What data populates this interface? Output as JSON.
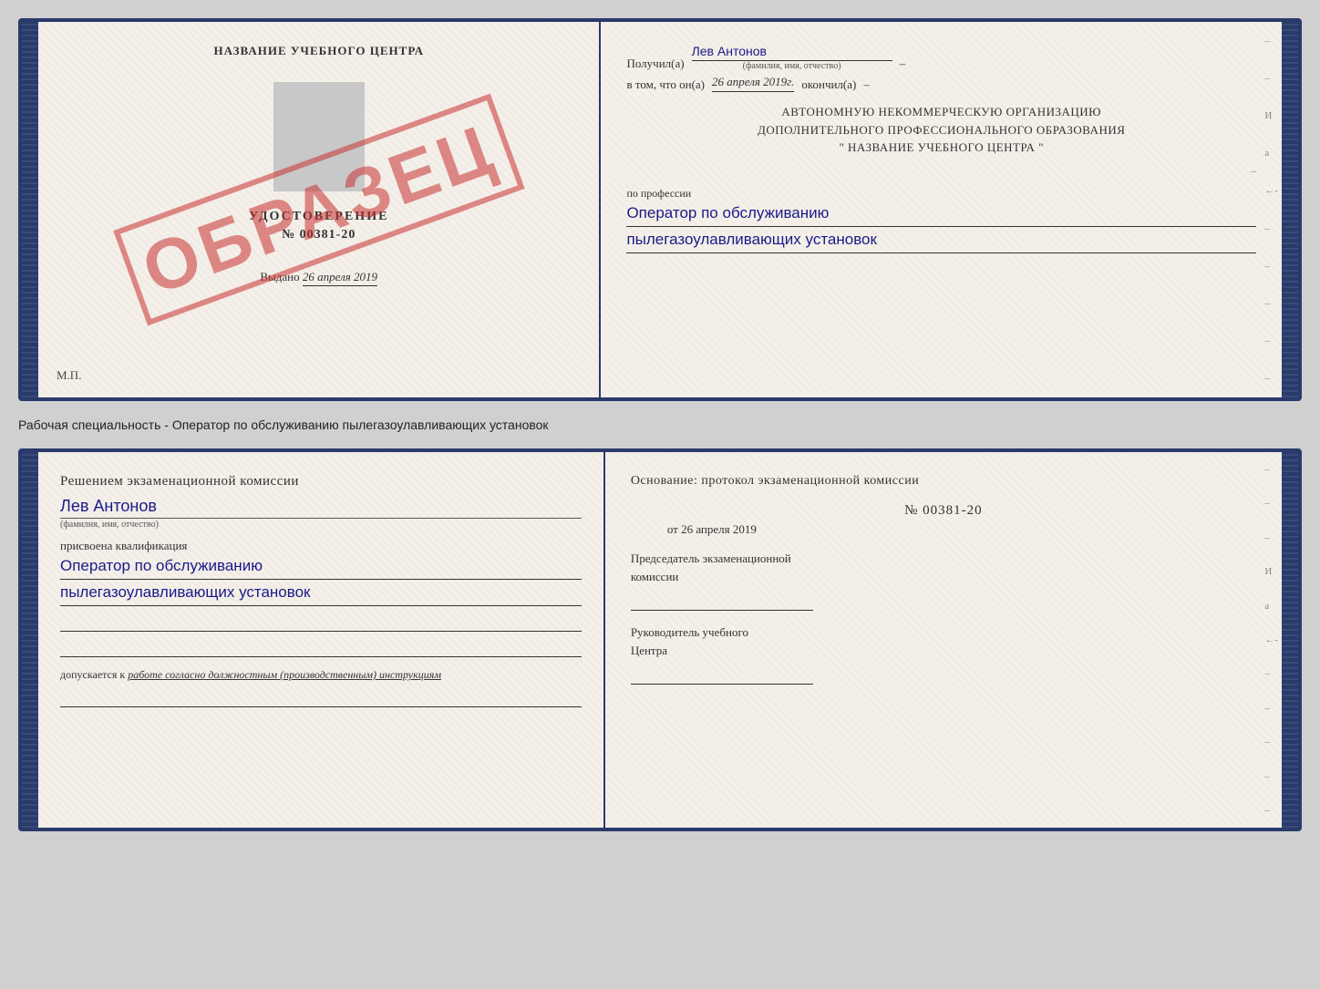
{
  "doc1": {
    "left": {
      "school_name": "НАЗВАНИЕ УЧЕБНОГО ЦЕНТРА",
      "udostoverenie": "УДОСТОВЕРЕНИЕ",
      "number": "№ 00381-20",
      "vydano_label": "Выдано",
      "vydano_date": "26 апреля 2019",
      "mp": "М.П.",
      "watermark": "ОБРАЗЕЦ"
    },
    "right": {
      "poluchil_label": "Получил(а)",
      "full_name": "Лев Антонов",
      "fio_sub": "(фамилия, имя, отчество)",
      "dash1": "–",
      "vtom_label": "в том, что он(а)",
      "date_italic": "26 апреля 2019г.",
      "okonchil": "окончил(а)",
      "dash2": "–",
      "org_line1": "АВТОНОМНУЮ НЕКОММЕРЧЕСКУЮ ОРГАНИЗАЦИЮ",
      "org_line2": "ДОПОЛНИТЕЛЬНОГО ПРОФЕССИОНАЛЬНОГО ОБРАЗОВАНИЯ",
      "org_line3": "\"   НАЗВАНИЕ УЧЕБНОГО ЦЕНТРА   \"",
      "dash3": "–",
      "i_label": "И",
      "a_label": "а",
      "dash4": "←-",
      "po_professii": "по профессии",
      "profession1": "Оператор по обслуживанию",
      "profession2": "пылегазоулавливающих установок",
      "dashes": [
        "–",
        "–",
        "–",
        "–",
        "–"
      ]
    }
  },
  "between": {
    "text": "Рабочая специальность - Оператор по обслуживанию пылегазоулавливающих установок"
  },
  "doc2": {
    "left": {
      "resheniem": "Решением экзаменационной комиссии",
      "full_name": "Лев Антонов",
      "fio_sub": "(фамилия, имя, отчество)",
      "prisvoyena": "присвоена квалификация",
      "qualification1": "Оператор по обслуживанию",
      "qualification2": "пылегазоулавливающих установок",
      "dopuskaetsya": "допускается к",
      "dopusk_italic": "работе согласно должностным (производственным) инструкциям"
    },
    "right": {
      "osnovaniye": "Основание: протокол экзаменационной комиссии",
      "number": "№  00381-20",
      "ot_label": "от",
      "date": "26 апреля 2019",
      "dash1": "–",
      "dash2": "–",
      "dash3": "–",
      "i_label": "И",
      "a_label": "а",
      "dash4": "←-",
      "predsedatel_line1": "Председатель экзаменационной",
      "predsedatel_line2": "комиссии",
      "rukovoditel_line1": "Руководитель учебного",
      "rukovoditel_line2": "Центра",
      "dashes": [
        "–",
        "–",
        "–",
        "–",
        "–"
      ]
    }
  }
}
